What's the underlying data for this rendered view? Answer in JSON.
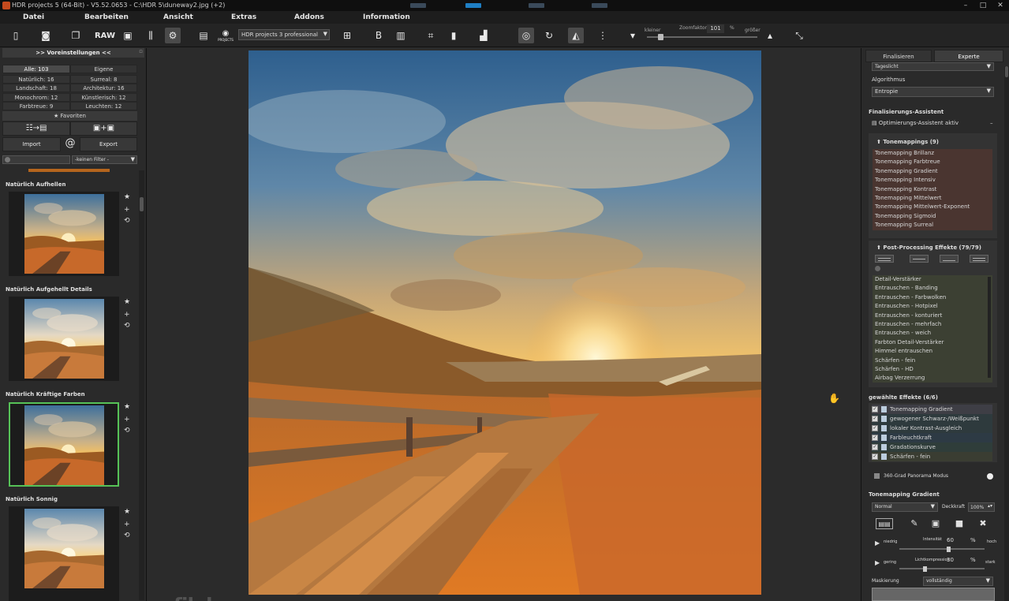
{
  "window": {
    "title": "HDR projects 5 (64-Bit) - V5.52.0653 - C:\\HDR 5\\duneway2.jpg (+2)",
    "controls": [
      "–",
      "□",
      "✕"
    ]
  },
  "menu": [
    "Datei",
    "Bearbeiten",
    "Ansicht",
    "Extras",
    "Addons",
    "Information"
  ],
  "toolbar": {
    "raw_label": "RAW",
    "projects_label": "PROJECTS",
    "preset_select": "HDR projects 3 professional",
    "zoom_small": "kleiner",
    "zoom_label": "Zoomfaktor",
    "zoom_value": "101",
    "zoom_unit": "%",
    "zoom_large": "größer"
  },
  "left_panel": {
    "header": ">> Voreinstellungen <<",
    "categories": [
      [
        "Alle: 103",
        "Eigene"
      ],
      [
        "Natürlich: 16",
        "Surreal: 8"
      ],
      [
        "Landschaft: 18",
        "Architektur: 16"
      ],
      [
        "Monochrom: 12",
        "Künstlerisch: 12"
      ],
      [
        "Farbtreue: 9",
        "Leuchten: 12"
      ]
    ],
    "favorites": "Favoriten",
    "import": "Import",
    "at": "@",
    "export": "Export",
    "filter": "-keinen Filter -",
    "presets": [
      "Natürlich Aufhellen",
      "Natürlich Aufgehellt Details",
      "Natürlich Kräftige Farben",
      "Natürlich Sonnig"
    ],
    "watermark": "filehorse.com"
  },
  "right_panel": {
    "tabs": [
      "Finalisieren",
      "Experte"
    ],
    "top_select": "Tageslicht",
    "algorithm_label": "Algorithmus",
    "algorithm_value": "Entropie",
    "wizard_title": "Finalisierungs-Assistent",
    "wizard_option": "Optimierungs-Assistent aktiv",
    "wizard_dash": "–",
    "tonemappings_title": "Tonemappings (9)",
    "tonemappings": [
      "Tonemapping Brillanz",
      "Tonemapping Farbtreue",
      "Tonemapping Gradient",
      "Tonemapping Intensiv",
      "Tonemapping Kontrast",
      "Tonemapping Mittelwert",
      "Tonemapping Mittelwert-Exponent",
      "Tonemapping Sigmoid",
      "Tonemapping Surreal"
    ],
    "post_title": "Post-Processing Effekte (79/79)",
    "post_effects": [
      "Detail-Verstärker",
      "Entrauschen - Banding",
      "Entrauschen - Farbwolken",
      "Entrauschen - Hotpixel",
      "Entrauschen - konturiert",
      "Entrauschen - mehrfach",
      "Entrauschen - weich",
      "Farbton Detail-Verstärker",
      "Himmel entrauschen",
      "Schärfen - fein",
      "Schärfen - HD",
      "Airbag Verzerrung"
    ],
    "selected_title": "gewählte Effekte (6/6)",
    "selected_effects": [
      {
        "label": "Tonemapping Gradient",
        "color": "#3e3e45"
      },
      {
        "label": "gewogener Schwarz-/Weißpunkt",
        "color": "#2e3a3d"
      },
      {
        "label": "lokaler Kontrast-Ausgleich",
        "color": "#2e3a3d"
      },
      {
        "label": "Farbleuchtkraft",
        "color": "#2d3a44"
      },
      {
        "label": "Gradationskurve",
        "color": "#2f3d3a"
      },
      {
        "label": "Schärfen - fein",
        "color": "#3a3d32"
      }
    ],
    "panorama": "360-Grad Panorama Modus",
    "gradient_title": "Tonemapping Gradient",
    "blend_mode": "Normal",
    "opacity_label": "Deckkraft",
    "opacity_value": "100%",
    "intensity_low": "niedrig",
    "intensity_label": "Intensität",
    "intensity_value": "60",
    "intensity_unit": "%",
    "intensity_high": "hoch",
    "light_low": "gering",
    "light_label": "Lichtkompression",
    "light_value": "30",
    "light_unit": "%",
    "light_high": "stark",
    "mask_label": "Maskierung",
    "mask_value": "vollständig"
  }
}
